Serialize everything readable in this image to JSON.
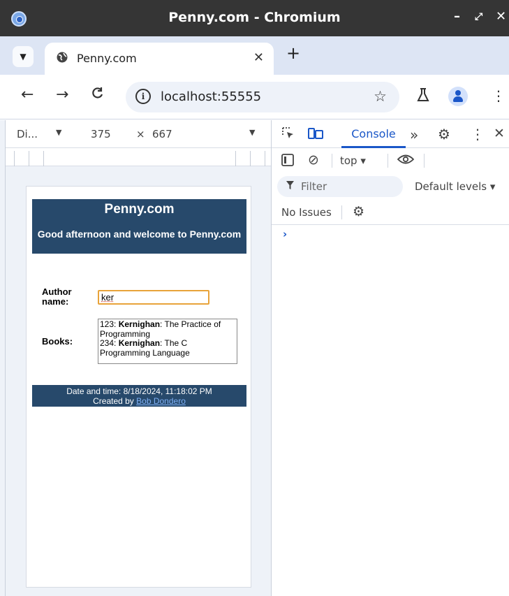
{
  "window": {
    "title": "Penny.com - Chromium",
    "controls": [
      "–",
      "⤢",
      "✕"
    ]
  },
  "tabs": [
    {
      "title": "Penny.com",
      "active": true
    }
  ],
  "toolbar": {
    "url": "localhost:55555"
  },
  "device_toolbar": {
    "device": "Di...",
    "width": "375",
    "times": "×",
    "height": "667"
  },
  "page": {
    "title": "Penny.com",
    "welcome": "Good afternoon and welcome to Penny.com",
    "author_label_line1": "Author",
    "author_label_line2": "name:",
    "author_value": "ker",
    "books_label": "Books:",
    "books": [
      {
        "id": "123: ",
        "author": "Kernighan",
        "title": ": The Practice of Programming"
      },
      {
        "id": "234: ",
        "author": "Kernighan",
        "title": ": The C Programming Language"
      }
    ],
    "footer_datetime": "Date and time: 8/18/2024, 11:18:02 PM",
    "footer_created": "Created by ",
    "footer_author_link": "Bob Dondero"
  },
  "devtools": {
    "active_tab": "Console",
    "more_tabs": "»",
    "context": "top ▾",
    "filter_placeholder": "Filter",
    "levels": "Default levels ▾",
    "issues": "No Issues",
    "prompt": "›"
  },
  "colors": {
    "page_header_bg": "#27496b",
    "accent_blue": "#1a57c8",
    "input_focus": "#e8a33a"
  }
}
